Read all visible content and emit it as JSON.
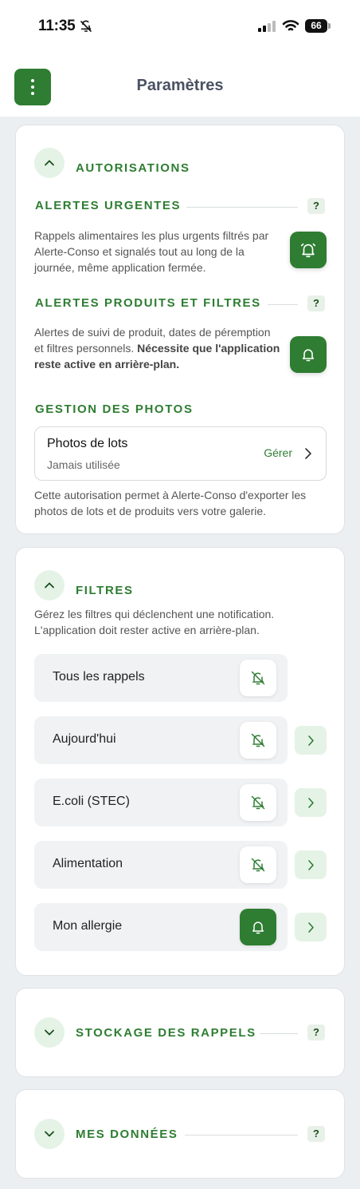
{
  "status_bar": {
    "time": "11:35",
    "battery": "66"
  },
  "header": {
    "title": "Paramètres"
  },
  "autorisations": {
    "title": "AUTORISATIONS",
    "alertes_urgentes": {
      "title": "ALERTES URGENTES",
      "help": "?",
      "description": "Rappels alimentaires les plus urgents filtrés par Alerte-Conso et signalés tout au long de la journée, même application fermée."
    },
    "alertes_produits": {
      "title": "ALERTES PRODUITS ET FILTRES",
      "help": "?",
      "description_normal": "Alertes de suivi de produit, dates de péremption et filtres personnels. ",
      "description_bold": "Nécessite que l'application reste active en arrière-plan."
    },
    "gestion_photos": {
      "title": "GESTION DES PHOTOS",
      "box_title": "Photos de lots",
      "box_subtitle": "Jamais utilisée",
      "manage_label": "Gérer",
      "description": "Cette autorisation permet à Alerte-Conso d'exporter les photos de lots et de produits vers votre galerie."
    }
  },
  "filtres": {
    "title": "FILTRES",
    "description": "Gérez les filtres qui déclenchent une notification. L'application doit rester active en arrière-plan.",
    "items": [
      {
        "label": "Tous les rappels",
        "enabled": false
      },
      {
        "label": "Aujourd'hui",
        "enabled": false
      },
      {
        "label": "E.coli (STEC)",
        "enabled": false
      },
      {
        "label": "Alimentation",
        "enabled": false
      },
      {
        "label": "Mon allergie",
        "enabled": true
      }
    ]
  },
  "stockage": {
    "title": "STOCKAGE DES RAPPELS",
    "help": "?"
  },
  "mes_donnees": {
    "title": "MES DONNÉES",
    "help": "?"
  },
  "colors": {
    "accent": "#2e7d32",
    "accent_light": "#e5f3e6",
    "background": "#eceff1"
  }
}
